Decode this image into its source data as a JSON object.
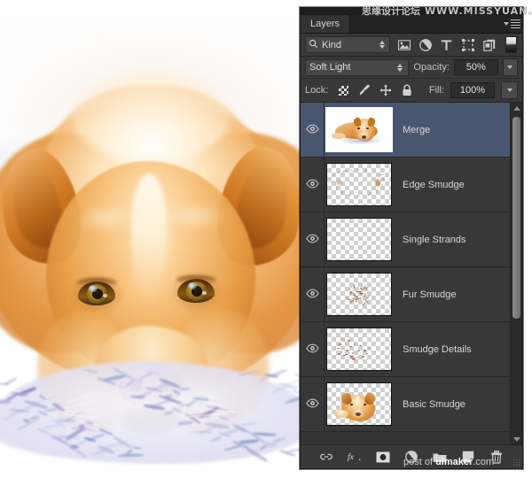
{
  "watermarks": {
    "top_cn": "思缘设计论坛",
    "top_url": "WWW.MISSYUAN.COM",
    "bottom_prefix": "post of ",
    "bottom_brand": "uimaker",
    "bottom_suffix": ".com"
  },
  "panel": {
    "tabs": [
      {
        "label": "Layers",
        "active": true
      }
    ],
    "menu_icon": "panel-menu-icon",
    "filter": {
      "kind_label": "Kind",
      "search_icon": "search-icon",
      "icons": [
        "pixel-layer-filter-icon",
        "adjustment-layer-filter-icon",
        "type-layer-filter-icon",
        "shape-layer-filter-icon",
        "smart-object-filter-icon"
      ],
      "toggle_name": "filter-enable-toggle"
    },
    "blend": {
      "mode": "Soft Light",
      "opacity_label": "Opacity:",
      "opacity_value": "50%"
    },
    "lock": {
      "label": "Lock:",
      "icons": [
        "lock-transparent-pixels-icon",
        "lock-image-pixels-icon",
        "lock-position-icon",
        "lock-all-icon"
      ],
      "fill_label": "Fill:",
      "fill_value": "100%"
    },
    "layers": [
      {
        "name": "Merge",
        "visible": true,
        "selected": true,
        "thumb": "merged-dog-on-white"
      },
      {
        "name": "Edge Smudge",
        "visible": true,
        "selected": false,
        "thumb": "edge-wisps-transparent"
      },
      {
        "name": "Single Strands",
        "visible": true,
        "selected": false,
        "thumb": "empty-transparent"
      },
      {
        "name": "Fur Smudge",
        "visible": true,
        "selected": false,
        "thumb": "fur-strokes-transparent"
      },
      {
        "name": "Smudge Details",
        "visible": true,
        "selected": false,
        "thumb": "detail-specks-transparent"
      },
      {
        "name": "Basic Smudge",
        "visible": true,
        "selected": false,
        "thumb": "dog-head-transparent"
      }
    ],
    "footer_buttons": [
      "link-layers-icon",
      "layer-style-fx-icon",
      "add-layer-mask-icon",
      "new-adjustment-layer-icon",
      "new-group-icon",
      "new-layer-icon",
      "delete-layer-icon"
    ],
    "scrollbar": {
      "up_arrow": "scroll-up-arrow",
      "down_arrow": "scroll-down-arrow",
      "thumb": "scroll-thumb"
    }
  },
  "canvas": {
    "artwork_title": "digital-painting-of-golden-dog-lying-on-blanket",
    "colors": {
      "fur_light": "#ffeccd",
      "fur_mid": "#e79d46",
      "fur_dark": "#cb7624",
      "nose_pink": "#e0a09f",
      "eye_amber": "#9e7526",
      "blanket": "#dad8ee",
      "background": "#ffffff"
    }
  }
}
